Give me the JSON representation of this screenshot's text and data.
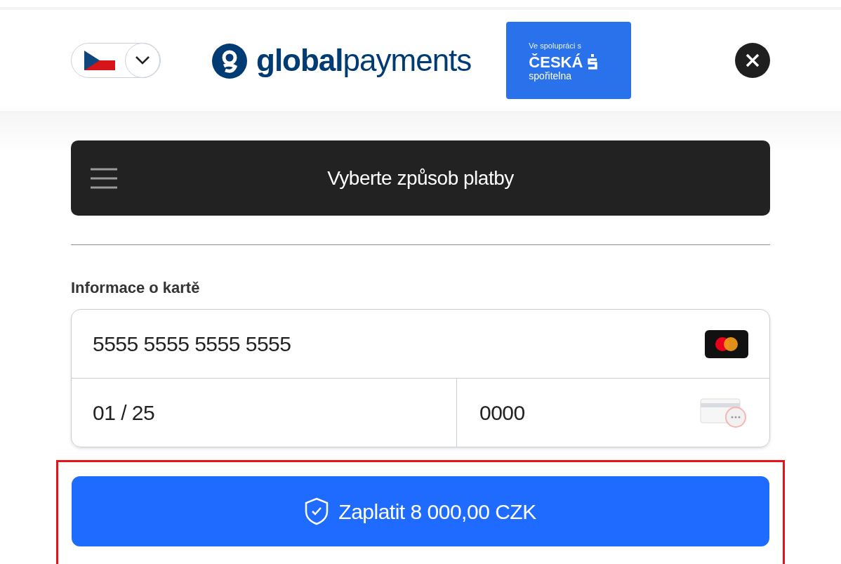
{
  "header": {
    "logo": "**global**payments",
    "partner": {
      "caption": "Ve spolupráci s",
      "name": "ČESKÁ",
      "sub": "spořitelna"
    }
  },
  "method_bar": {
    "title": "Vyberte způsob platby"
  },
  "card": {
    "label": "Informace o kartě",
    "number": "5555 5555 5555 5555",
    "expiry": "01 / 25",
    "cvc": "0000"
  },
  "pay_button": {
    "label": "Zaplatit 8 000,00 CZK",
    "highlighted": true
  }
}
